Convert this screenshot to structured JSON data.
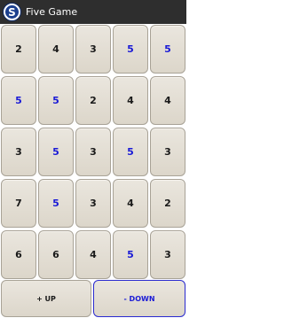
{
  "app": {
    "icon_letter": "S",
    "title": "Five Game"
  },
  "grid": {
    "rows": [
      [
        "2",
        "4",
        "3",
        "5",
        "5"
      ],
      [
        "5",
        "5",
        "2",
        "4",
        "4"
      ],
      [
        "3",
        "5",
        "3",
        "5",
        "3"
      ],
      [
        "7",
        "5",
        "3",
        "4",
        "2"
      ],
      [
        "6",
        "6",
        "4",
        "5",
        "3"
      ]
    ]
  },
  "controls": {
    "up_label": "+ UP",
    "down_label": "- DOWN"
  },
  "colors": {
    "highlight_five": "#1a1ad6",
    "selected_border": "#2a2ad0",
    "titlebar": "#2e2e2e"
  }
}
